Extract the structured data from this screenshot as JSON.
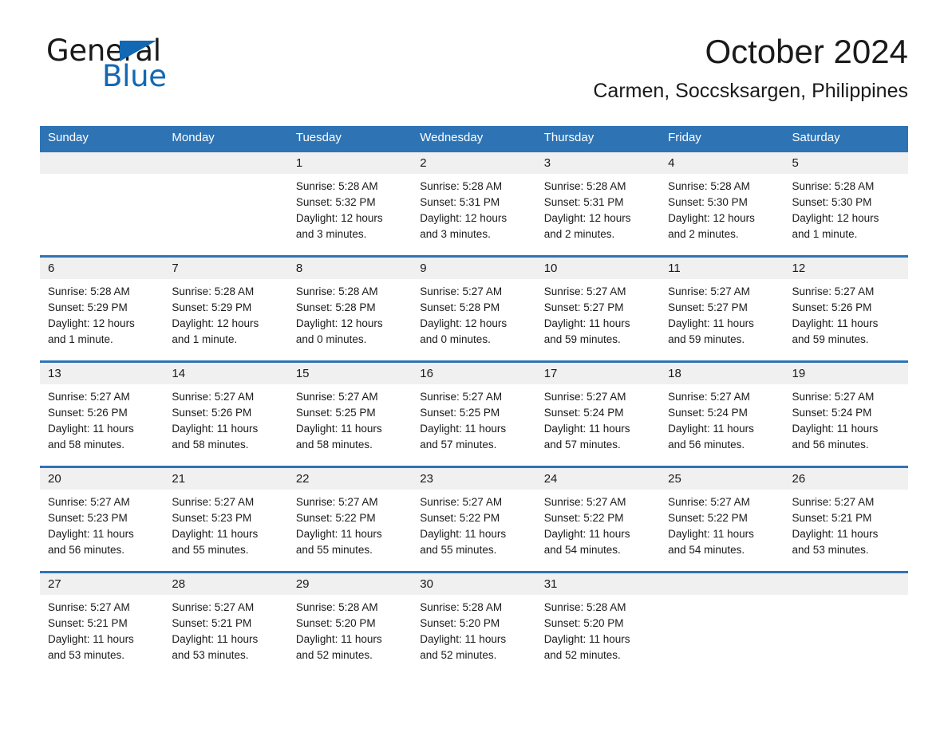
{
  "brand": {
    "word1": "General",
    "word2": "Blue",
    "accent_color": "#1268b3",
    "logo_icon": "triangle-flag-icon"
  },
  "header": {
    "month_title": "October 2024",
    "location": "Carmen, Soccsksargen, Philippines"
  },
  "calendar": {
    "header_color": "#2e74b5",
    "daynum_band_color": "#f0f0f0",
    "weekdays": [
      "Sunday",
      "Monday",
      "Tuesday",
      "Wednesday",
      "Thursday",
      "Friday",
      "Saturday"
    ],
    "weeks": [
      [
        {
          "day": "",
          "info": ""
        },
        {
          "day": "",
          "info": ""
        },
        {
          "day": "1",
          "info": "Sunrise: 5:28 AM\nSunset: 5:32 PM\nDaylight: 12 hours\nand 3 minutes."
        },
        {
          "day": "2",
          "info": "Sunrise: 5:28 AM\nSunset: 5:31 PM\nDaylight: 12 hours\nand 3 minutes."
        },
        {
          "day": "3",
          "info": "Sunrise: 5:28 AM\nSunset: 5:31 PM\nDaylight: 12 hours\nand 2 minutes."
        },
        {
          "day": "4",
          "info": "Sunrise: 5:28 AM\nSunset: 5:30 PM\nDaylight: 12 hours\nand 2 minutes."
        },
        {
          "day": "5",
          "info": "Sunrise: 5:28 AM\nSunset: 5:30 PM\nDaylight: 12 hours\nand 1 minute."
        }
      ],
      [
        {
          "day": "6",
          "info": "Sunrise: 5:28 AM\nSunset: 5:29 PM\nDaylight: 12 hours\nand 1 minute."
        },
        {
          "day": "7",
          "info": "Sunrise: 5:28 AM\nSunset: 5:29 PM\nDaylight: 12 hours\nand 1 minute."
        },
        {
          "day": "8",
          "info": "Sunrise: 5:28 AM\nSunset: 5:28 PM\nDaylight: 12 hours\nand 0 minutes."
        },
        {
          "day": "9",
          "info": "Sunrise: 5:27 AM\nSunset: 5:28 PM\nDaylight: 12 hours\nand 0 minutes."
        },
        {
          "day": "10",
          "info": "Sunrise: 5:27 AM\nSunset: 5:27 PM\nDaylight: 11 hours\nand 59 minutes."
        },
        {
          "day": "11",
          "info": "Sunrise: 5:27 AM\nSunset: 5:27 PM\nDaylight: 11 hours\nand 59 minutes."
        },
        {
          "day": "12",
          "info": "Sunrise: 5:27 AM\nSunset: 5:26 PM\nDaylight: 11 hours\nand 59 minutes."
        }
      ],
      [
        {
          "day": "13",
          "info": "Sunrise: 5:27 AM\nSunset: 5:26 PM\nDaylight: 11 hours\nand 58 minutes."
        },
        {
          "day": "14",
          "info": "Sunrise: 5:27 AM\nSunset: 5:26 PM\nDaylight: 11 hours\nand 58 minutes."
        },
        {
          "day": "15",
          "info": "Sunrise: 5:27 AM\nSunset: 5:25 PM\nDaylight: 11 hours\nand 58 minutes."
        },
        {
          "day": "16",
          "info": "Sunrise: 5:27 AM\nSunset: 5:25 PM\nDaylight: 11 hours\nand 57 minutes."
        },
        {
          "day": "17",
          "info": "Sunrise: 5:27 AM\nSunset: 5:24 PM\nDaylight: 11 hours\nand 57 minutes."
        },
        {
          "day": "18",
          "info": "Sunrise: 5:27 AM\nSunset: 5:24 PM\nDaylight: 11 hours\nand 56 minutes."
        },
        {
          "day": "19",
          "info": "Sunrise: 5:27 AM\nSunset: 5:24 PM\nDaylight: 11 hours\nand 56 minutes."
        }
      ],
      [
        {
          "day": "20",
          "info": "Sunrise: 5:27 AM\nSunset: 5:23 PM\nDaylight: 11 hours\nand 56 minutes."
        },
        {
          "day": "21",
          "info": "Sunrise: 5:27 AM\nSunset: 5:23 PM\nDaylight: 11 hours\nand 55 minutes."
        },
        {
          "day": "22",
          "info": "Sunrise: 5:27 AM\nSunset: 5:22 PM\nDaylight: 11 hours\nand 55 minutes."
        },
        {
          "day": "23",
          "info": "Sunrise: 5:27 AM\nSunset: 5:22 PM\nDaylight: 11 hours\nand 55 minutes."
        },
        {
          "day": "24",
          "info": "Sunrise: 5:27 AM\nSunset: 5:22 PM\nDaylight: 11 hours\nand 54 minutes."
        },
        {
          "day": "25",
          "info": "Sunrise: 5:27 AM\nSunset: 5:22 PM\nDaylight: 11 hours\nand 54 minutes."
        },
        {
          "day": "26",
          "info": "Sunrise: 5:27 AM\nSunset: 5:21 PM\nDaylight: 11 hours\nand 53 minutes."
        }
      ],
      [
        {
          "day": "27",
          "info": "Sunrise: 5:27 AM\nSunset: 5:21 PM\nDaylight: 11 hours\nand 53 minutes."
        },
        {
          "day": "28",
          "info": "Sunrise: 5:27 AM\nSunset: 5:21 PM\nDaylight: 11 hours\nand 53 minutes."
        },
        {
          "day": "29",
          "info": "Sunrise: 5:28 AM\nSunset: 5:20 PM\nDaylight: 11 hours\nand 52 minutes."
        },
        {
          "day": "30",
          "info": "Sunrise: 5:28 AM\nSunset: 5:20 PM\nDaylight: 11 hours\nand 52 minutes."
        },
        {
          "day": "31",
          "info": "Sunrise: 5:28 AM\nSunset: 5:20 PM\nDaylight: 11 hours\nand 52 minutes."
        },
        {
          "day": "",
          "info": ""
        },
        {
          "day": "",
          "info": ""
        }
      ]
    ]
  }
}
